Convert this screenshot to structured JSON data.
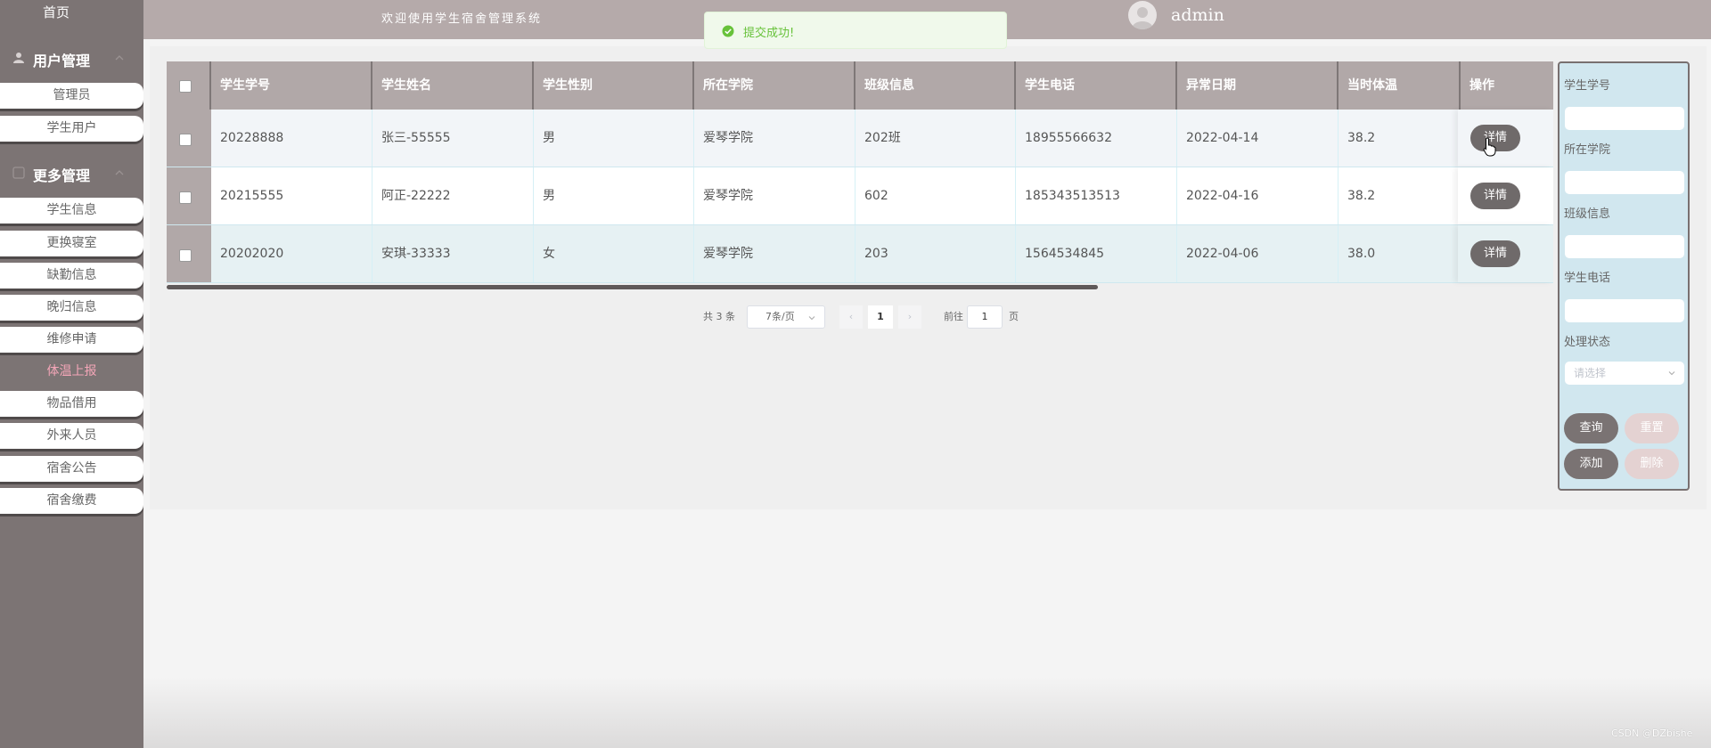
{
  "sidebar": {
    "home": "首页",
    "groups": [
      {
        "label": "用户管理",
        "items": [
          "管理员",
          "学生用户"
        ]
      },
      {
        "label": "更多管理",
        "items": [
          "学生信息",
          "更换寝室",
          "缺勤信息",
          "晚归信息",
          "维修申请",
          "体温上报",
          "物品借用",
          "外来人员",
          "宿舍公告",
          "宿舍缴费"
        ]
      }
    ],
    "active_item": "体温上报"
  },
  "header": {
    "title": "欢迎使用学生宿舍管理系统",
    "username": "admin"
  },
  "toast": {
    "message": "提交成功!",
    "type": "success"
  },
  "table": {
    "columns": [
      "学生学号",
      "学生姓名",
      "学生性别",
      "所在学院",
      "班级信息",
      "学生电话",
      "异常日期",
      "当时体温",
      "操作"
    ],
    "rows": [
      {
        "id": "20228888",
        "name": "张三-55555",
        "gender": "男",
        "college": "爱琴学院",
        "class": "202班",
        "phone": "18955566632",
        "date": "2022-04-14",
        "temp": "38.2",
        "action": "详情"
      },
      {
        "id": "20215555",
        "name": "阿正-22222",
        "gender": "男",
        "college": "爱琴学院",
        "class": "602",
        "phone": "185343513513",
        "date": "2022-04-16",
        "temp": "38.2",
        "action": "详情"
      },
      {
        "id": "20202020",
        "name": "安琪-33333",
        "gender": "女",
        "college": "爱琴学院",
        "class": "203",
        "phone": "1564534845",
        "date": "2022-04-06",
        "temp": "38.0",
        "action": "详情"
      }
    ]
  },
  "pagination": {
    "total_text": "共 3 条",
    "page_size": "7条/页",
    "prev": "‹",
    "current_page": "1",
    "next": "›",
    "goto_label": "前往",
    "goto_value": "1",
    "page_suffix": "页"
  },
  "search": {
    "fields": [
      "学生学号",
      "所在学院",
      "班级信息",
      "学生电话"
    ],
    "status_label": "处理状态",
    "status_placeholder": "请选择",
    "buttons": {
      "query": "查询",
      "reset": "重置",
      "add": "添加",
      "delete": "删除"
    }
  },
  "watermark": "CSDN @DZbishe",
  "colors": {
    "sidebar": "#7c7474",
    "header": "#b5aaaa",
    "table_header": "#b1a8a8",
    "search_panel": "#d1e7ef",
    "active_menu": "#f4a6b8",
    "success": "#67c23a"
  },
  "icons": [
    "user-icon",
    "grid-icon",
    "chevron-up-icon",
    "avatar-icon",
    "check-circle-icon",
    "chevron-down-icon",
    "cursor-icon"
  ]
}
